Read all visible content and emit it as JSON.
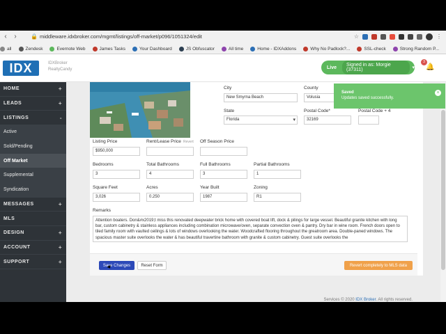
{
  "browser": {
    "url": "middleware.idxbroker.com/mgmt/listings/off-market/p096/1051324/edit",
    "bookmarks": [
      "all",
      "Zendesk",
      "Evernote Web",
      "James Tasks",
      "Your Dashboard",
      "JS Obfuscator",
      "All time",
      "Home - IDXAddons",
      "Why No Padlock?...",
      "SSL-check",
      "Strong Random P..."
    ],
    "bookmark_colors": [
      "#888888",
      "#555555",
      "#5cb85c",
      "#c0392b",
      "#2c6fb5",
      "#2c3e50",
      "#8e44ad",
      "#2c6fb5",
      "#c0392b",
      "#c0392b",
      "#8e44ad"
    ]
  },
  "header": {
    "logo": "IDX",
    "sublogo_line1": "IDXBroker",
    "sublogo_line2": "RealtyCandy",
    "live_label": "Live",
    "signed_in": "Signed in as: Morgie (37311)",
    "notification_count": "3"
  },
  "sidebar": {
    "items": [
      {
        "label": "HOME",
        "type": "sec",
        "plus": "+"
      },
      {
        "label": "LEADS",
        "type": "sec",
        "plus": "+"
      },
      {
        "label": "LISTINGS",
        "type": "sec",
        "plus": "-"
      },
      {
        "label": "Active",
        "type": "sub",
        "plus": ""
      },
      {
        "label": "Sold/Pending",
        "type": "sub",
        "plus": ""
      },
      {
        "label": "Off Market",
        "type": "active",
        "plus": ""
      },
      {
        "label": "Supplemental",
        "type": "sub",
        "plus": ""
      },
      {
        "label": "Syndication",
        "type": "sub",
        "plus": ""
      },
      {
        "label": "MESSAGES",
        "type": "sec",
        "plus": "+"
      },
      {
        "label": "MLS",
        "type": "sec",
        "plus": ""
      },
      {
        "label": "DESIGN",
        "type": "sec",
        "plus": "+"
      },
      {
        "label": "ACCOUNT",
        "type": "sec",
        "plus": "+"
      },
      {
        "label": "SUPPORT",
        "type": "sec",
        "plus": "+"
      }
    ]
  },
  "form": {
    "city_label": "City",
    "city": "New Smyrna Beach",
    "county_label": "County",
    "county": "Volusia",
    "state_label": "State",
    "state": "Florida",
    "postal_label": "Postal Code*",
    "postal": "32169",
    "postal4_label": "Postal Code + 4",
    "postal4": "",
    "listing_price_label": "Listing Price",
    "listing_price": "$950,000",
    "rent_label": "Rent/Lease Price",
    "rent_hint": "Revert",
    "rent": "",
    "offseason_label": "Off Season Price",
    "offseason": "",
    "bedrooms_label": "Bedrooms",
    "bedrooms": "3",
    "total_baths_label": "Total Bathrooms",
    "total_baths": "4",
    "full_baths_label": "Full Bathrooms",
    "full_baths": "3",
    "partial_baths_label": "Partial Bathrooms",
    "partial_baths": "1",
    "sqft_label": "Square Feet",
    "sqft": "3,026",
    "acres_label": "Acres",
    "acres": "0.250",
    "year_label": "Year Built",
    "year": "1987",
    "zoning_label": "Zoning",
    "zoning": "R1",
    "remarks_label": "Remarks",
    "remarks": "Attention boaters.  Don&#x2019;t miss this renovated deepwater brick home with covered boat lift, dock & pilings for large vessel.  Beautiful granite kitchen with long bar, custom cabinetry & stainless appliances including combination microwave/oven, separate convection oven & pantry.  Dry bar in wine room.   French doors open to tiled family room with vaulted ceilings & lots of windows overlooking the water. Woodcrafted flooring throughout the greatroom area. Double-paned windows.   The spacious master suite overlooks the water & has beautiful travertine bathroom with granite & custom cabinetry.  Guest suite overlooks the"
  },
  "buttons": {
    "save": "Save Changes",
    "reset": "Reset Form",
    "revert": "Revert completely to MLS data"
  },
  "toast": {
    "title": "Saved",
    "message": "Updates saved successfully."
  },
  "footer": {
    "text": "Services © 2020 ",
    "brand": "IDX Broker",
    "rest": ". All rights reserved."
  },
  "colors": {
    "sidebar": "#2e3338",
    "accent": "#2c49b8",
    "success": "#5cb85c",
    "revert": "#f0a14a"
  }
}
